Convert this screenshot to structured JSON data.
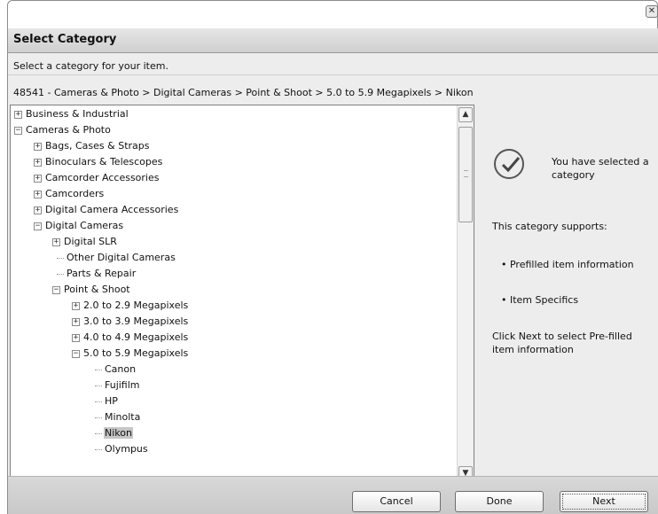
{
  "window": {
    "close_glyph": "✕"
  },
  "header": {
    "title": "Select Category"
  },
  "instruction": "Select a category for your item.",
  "breadcrumb": "48541 - Cameras & Photo > Digital Cameras > Point & Shoot > 5.0 to 5.9 Megapixels > Nikon",
  "tree": {
    "items": [
      {
        "label": "Business & Industrial",
        "expander": "+"
      },
      {
        "label": "Cameras & Photo",
        "expander": "−"
      },
      {
        "label": "Bags, Cases & Straps",
        "expander": "+"
      },
      {
        "label": "Binoculars  & Telescopes",
        "expander": "+"
      },
      {
        "label": "Camcorder Accessories",
        "expander": "+"
      },
      {
        "label": "Camcorders",
        "expander": "+"
      },
      {
        "label": "Digital Camera Accessories",
        "expander": "+"
      },
      {
        "label": "Digital Cameras",
        "expander": "−"
      },
      {
        "label": "Digital SLR",
        "expander": "+"
      },
      {
        "label": "Other Digital Cameras",
        "expander": ""
      },
      {
        "label": "Parts & Repair",
        "expander": ""
      },
      {
        "label": "Point & Shoot",
        "expander": "−"
      },
      {
        "label": "2.0 to 2.9 Megapixels",
        "expander": "+"
      },
      {
        "label": "3.0 to 3.9 Megapixels",
        "expander": "+"
      },
      {
        "label": "4.0 to 4.9 Megapixels",
        "expander": "+"
      },
      {
        "label": "5.0 to 5.9 Megapixels",
        "expander": "−"
      },
      {
        "label": "Canon",
        "expander": ""
      },
      {
        "label": "Fujifilm",
        "expander": ""
      },
      {
        "label": "HP",
        "expander": ""
      },
      {
        "label": "Minolta",
        "expander": ""
      },
      {
        "label": "Nikon",
        "expander": "",
        "selected": true
      },
      {
        "label": "Olympus",
        "expander": ""
      }
    ]
  },
  "scrollbar": {
    "up": "▲",
    "down": "▼"
  },
  "info": {
    "selected_message": "You have selected a category",
    "supports": "This category supports:",
    "feature_1": "• Prefilled item information",
    "feature_2": "• Item Specifics",
    "hint": "Click Next to select Pre-filled item information"
  },
  "buttons": {
    "cancel": "Cancel",
    "done": "Done",
    "next": "Next"
  },
  "icons": {
    "check": "check-circle-icon",
    "close": "close-icon"
  }
}
